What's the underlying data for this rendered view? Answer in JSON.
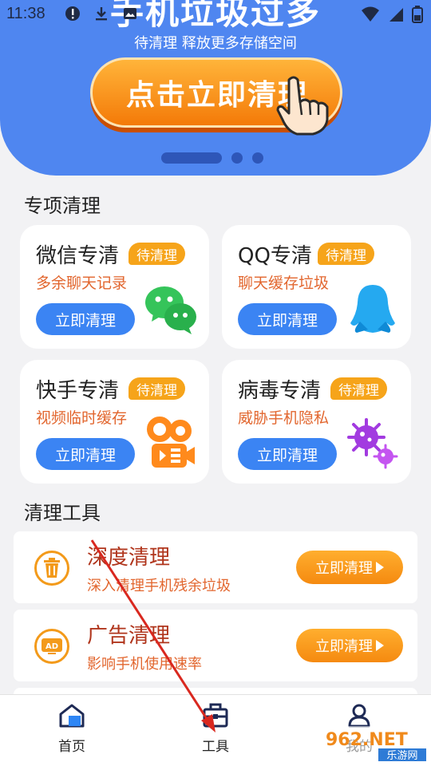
{
  "status_bar": {
    "time": "11:38"
  },
  "banner": {
    "title": "手机垃圾过多",
    "subtitle": "待清理 释放更多存储空间",
    "button_label": "点击立即清理"
  },
  "special": {
    "title": "专项清理",
    "cards": [
      {
        "name": "微信专清",
        "badge": "待清理",
        "desc": "多余聊天记录",
        "button": "立即清理",
        "icon": "wechat-icon"
      },
      {
        "name": "QQ专清",
        "badge": "待清理",
        "desc": "聊天缓存垃圾",
        "button": "立即清理",
        "icon": "qq-penguin-icon"
      },
      {
        "name": "快手专清",
        "badge": "待清理",
        "desc": "视频临时缓存",
        "button": "立即清理",
        "icon": "kuaishou-icon"
      },
      {
        "name": "病毒专清",
        "badge": "待清理",
        "desc": "威胁手机隐私",
        "button": "立即清理",
        "icon": "virus-icon"
      }
    ]
  },
  "tools": {
    "title": "清理工具",
    "items": [
      {
        "name": "深度清理",
        "desc": "深入清理手机残余垃圾",
        "button": "立即清理",
        "icon": "trash-icon"
      },
      {
        "name": "广告清理",
        "desc": "影响手机使用速率",
        "button": "立即清理",
        "icon": "ad-icon",
        "icon_text": "AD"
      }
    ]
  },
  "bottom_nav": [
    {
      "label": "首页",
      "icon": "home-icon"
    },
    {
      "label": "工具",
      "icon": "toolbox-icon"
    },
    {
      "label": "我的",
      "icon": "profile-icon"
    }
  ],
  "watermark": {
    "brand": "962.NET",
    "sub": "乐游网"
  },
  "colors": {
    "primary_blue": "#4f86f0",
    "button_blue": "#3b84f3",
    "orange": "#f6a41a",
    "red_text": "#b0351c"
  }
}
